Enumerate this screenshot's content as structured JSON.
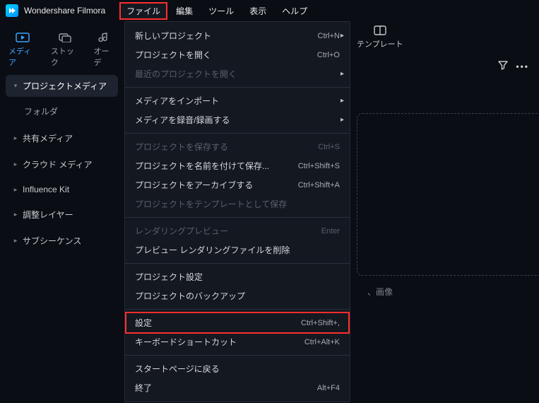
{
  "app": {
    "title": "Wondershare Filmora"
  },
  "menubar": [
    "ファイル",
    "編集",
    "ツール",
    "表示",
    "ヘルプ"
  ],
  "active_menu_index": 0,
  "left_tabs": [
    {
      "label": "メディア",
      "icon": "media-icon",
      "active": true
    },
    {
      "label": "ストック",
      "icon": "stock-icon"
    },
    {
      "label": "オーデ",
      "icon": "audio-icon"
    }
  ],
  "right_tab": {
    "label": "テンプレート",
    "icon": "template-icon"
  },
  "sidebar": {
    "items": [
      {
        "label": "プロジェクトメディア",
        "selected": true,
        "expand": "down",
        "sub": "フォルダ"
      },
      {
        "label": "共有メディア",
        "expand": "right"
      },
      {
        "label": "クラウド メディア",
        "expand": "right"
      },
      {
        "label": "Influence Kit",
        "expand": "right"
      },
      {
        "label": "調整レイヤー",
        "expand": "right"
      },
      {
        "label": "サブシーケンス",
        "expand": "right"
      }
    ]
  },
  "drop_hint_suffix": "、画像",
  "dropdown": {
    "groups": [
      [
        {
          "label": "新しいプロジェクト",
          "shortcut": "Ctrl+N",
          "submenu": true
        },
        {
          "label": "プロジェクトを開く",
          "shortcut": "Ctrl+O"
        },
        {
          "label": "最近のプロジェクトを開く",
          "disabled": true,
          "submenu": true
        }
      ],
      [
        {
          "label": "メディアをインポート",
          "submenu": true
        },
        {
          "label": "メディアを録音/録画する",
          "submenu": true
        }
      ],
      [
        {
          "label": "プロジェクトを保存する",
          "shortcut": "Ctrl+S",
          "disabled": true
        },
        {
          "label": "プロジェクトを名前を付けて保存...",
          "shortcut": "Ctrl+Shift+S"
        },
        {
          "label": "プロジェクトをアーカイブする",
          "shortcut": "Ctrl+Shift+A"
        },
        {
          "label": "プロジェクトをテンプレートとして保存",
          "disabled": true
        }
      ],
      [
        {
          "label": "レンダリングプレビュー",
          "shortcut": "Enter",
          "disabled": true
        },
        {
          "label": "プレビュー レンダリングファイルを削除"
        }
      ],
      [
        {
          "label": "プロジェクト設定"
        },
        {
          "label": "プロジェクトのバックアップ"
        }
      ],
      [
        {
          "label": "設定",
          "shortcut": "Ctrl+Shift+,",
          "highlight": true
        },
        {
          "label": "キーボードショートカット",
          "shortcut": "Ctrl+Alt+K"
        }
      ],
      [
        {
          "label": "スタートページに戻る"
        },
        {
          "label": "終了",
          "shortcut": "Alt+F4"
        }
      ]
    ]
  }
}
